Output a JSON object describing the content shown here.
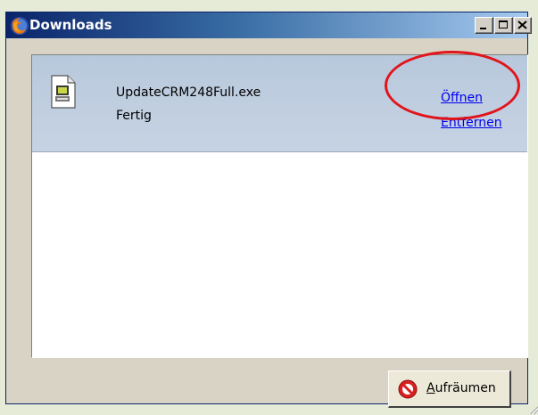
{
  "window": {
    "title": "Downloads",
    "controls": {
      "minimize": "_",
      "maximize": "□",
      "close": "×"
    }
  },
  "downloads": [
    {
      "file_name": "UpdateCRM248Full.exe",
      "status": "Fertig",
      "actions": {
        "open": "Öffnen",
        "remove": "Entfernen"
      },
      "icon": "installer-file-icon"
    }
  ],
  "footer": {
    "clear_button_label": "Aufräumen",
    "clear_button_access_key": "A",
    "clear_button_rest": "ufräumen",
    "clear_icon": "prohibited-icon"
  },
  "annotation": {
    "shape": "ellipse",
    "color": "#e1141b",
    "target": "download-actions"
  }
}
